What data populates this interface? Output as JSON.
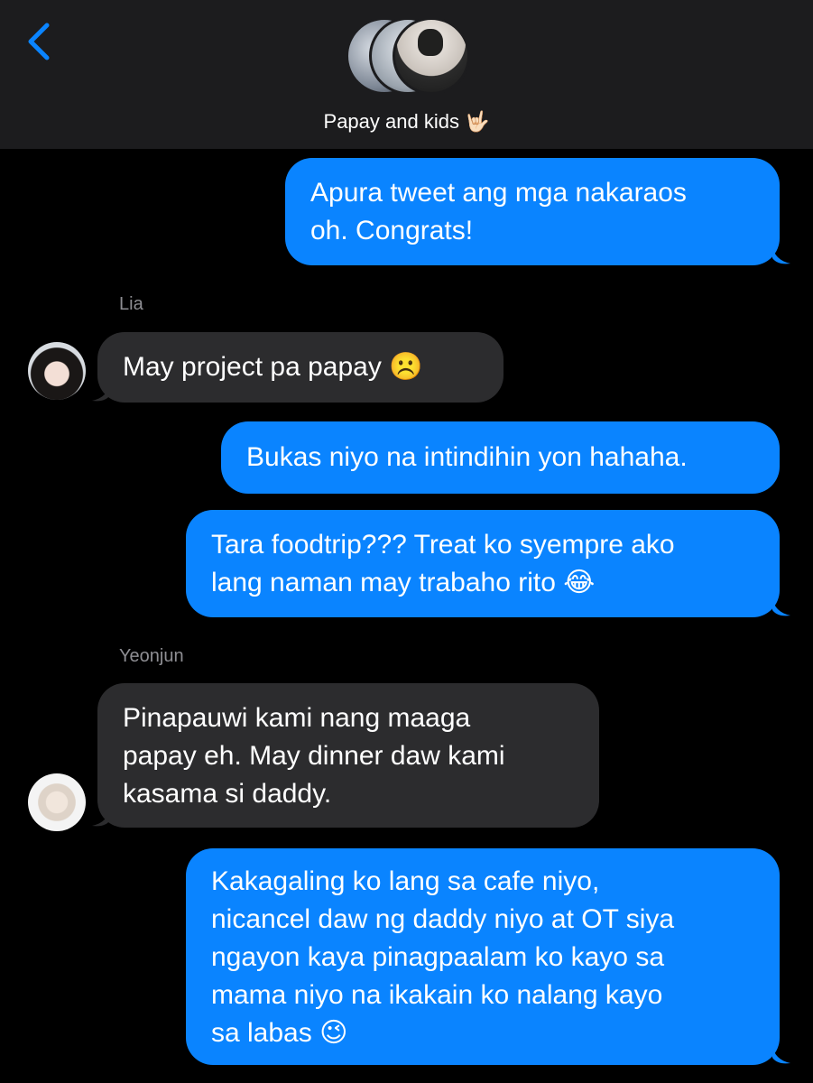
{
  "header": {
    "back_icon": "chevron-left-icon",
    "title": "Papay and kids 🤟🏻",
    "accent_color": "#0a84ff"
  },
  "messages": [
    {
      "direction": "outgoing",
      "text": "Apura tweet ang mga nakaraos\noh. Congrats!"
    },
    {
      "sender": "Lia",
      "direction": "incoming",
      "text": "May project pa papay ☹️"
    },
    {
      "direction": "outgoing",
      "text": "Bukas niyo na intindihin yon hahaha."
    },
    {
      "direction": "outgoing",
      "text": "Tara foodtrip??? Treat ko syempre ako\nlang naman may trabaho rito 😂"
    },
    {
      "sender": "Yeonjun",
      "direction": "incoming",
      "text": "Pinapauwi kami nang maaga\npapay eh. May dinner daw kami\nkasama si daddy."
    },
    {
      "direction": "outgoing",
      "text": "Kakagaling ko lang sa cafe niyo,\nnicancel daw ng daddy niyo at OT siya\nngayon kaya pinagpaalam ko kayo sa\nmama niyo na ikakain ko nalang kayo\nsa labas 😉"
    }
  ]
}
